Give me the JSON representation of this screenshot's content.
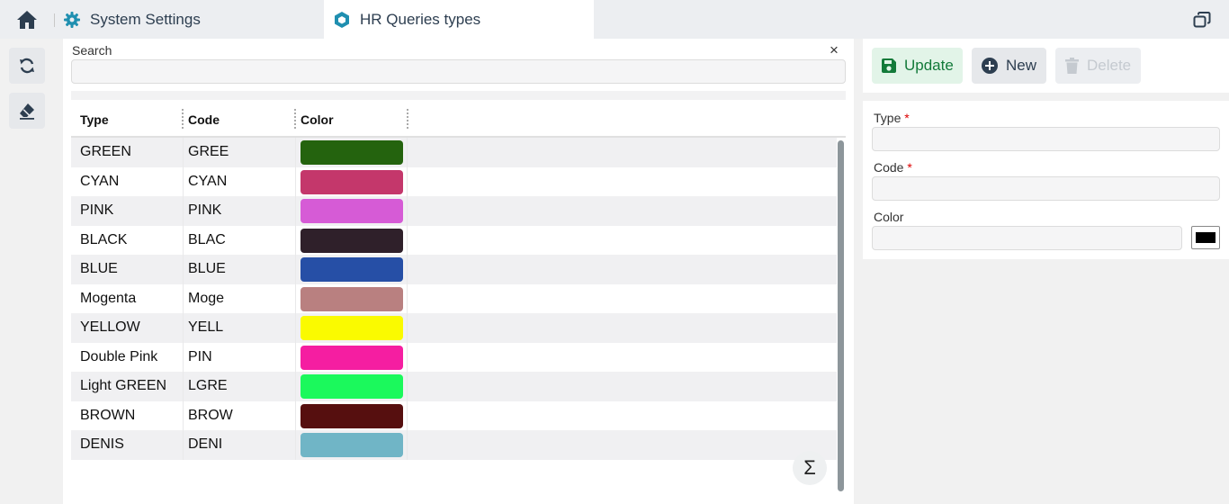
{
  "tabs": [
    {
      "label": "System Settings",
      "icon": "gear-icon",
      "active": false
    },
    {
      "label": "HR Queries types",
      "icon": "hexagon-icon",
      "active": true
    }
  ],
  "search": {
    "label": "Search",
    "value": ""
  },
  "grid": {
    "columns": [
      {
        "label": "Type"
      },
      {
        "label": "Code"
      },
      {
        "label": "Color"
      }
    ],
    "rows": [
      {
        "type": "GREEN",
        "code": "GREE",
        "color": "#24630e"
      },
      {
        "type": "CYAN",
        "code": "CYAN",
        "color": "#c4376b"
      },
      {
        "type": "PINK",
        "code": "PINK",
        "color": "#d65bd6"
      },
      {
        "type": "BLACK",
        "code": "BLAC",
        "color": "#2f202a"
      },
      {
        "type": "BLUE",
        "code": "BLUE",
        "color": "#264fa6"
      },
      {
        "type": "Mogenta",
        "code": "Moge",
        "color": "#b98080"
      },
      {
        "type": "YELLOW",
        "code": "YELL",
        "color": "#fafa00"
      },
      {
        "type": "Double Pink",
        "code": "PIN",
        "color": "#f51ea1"
      },
      {
        "type": "Light GREEN",
        "code": "LGRE",
        "color": "#1bf95c"
      },
      {
        "type": "BROWN",
        "code": "BROW",
        "color": "#560f0f"
      },
      {
        "type": "DENIS",
        "code": "DENI",
        "color": "#70b5c6"
      }
    ]
  },
  "toolbar": {
    "update_label": "Update",
    "new_label": "New",
    "delete_label": "Delete"
  },
  "form": {
    "type_label": "Type",
    "code_label": "Code",
    "color_label": "Color",
    "required_mark": "*",
    "type_value": "",
    "code_value": "",
    "color_value": "",
    "color_swatch": "#000000"
  },
  "icons": {
    "home": "home-icon",
    "restore": "restore-window-icon",
    "refresh": "refresh-icon",
    "clear": "eraser-icon",
    "summary": "sigma-icon"
  },
  "summary_symbol": "Σ",
  "close_symbol": "×"
}
